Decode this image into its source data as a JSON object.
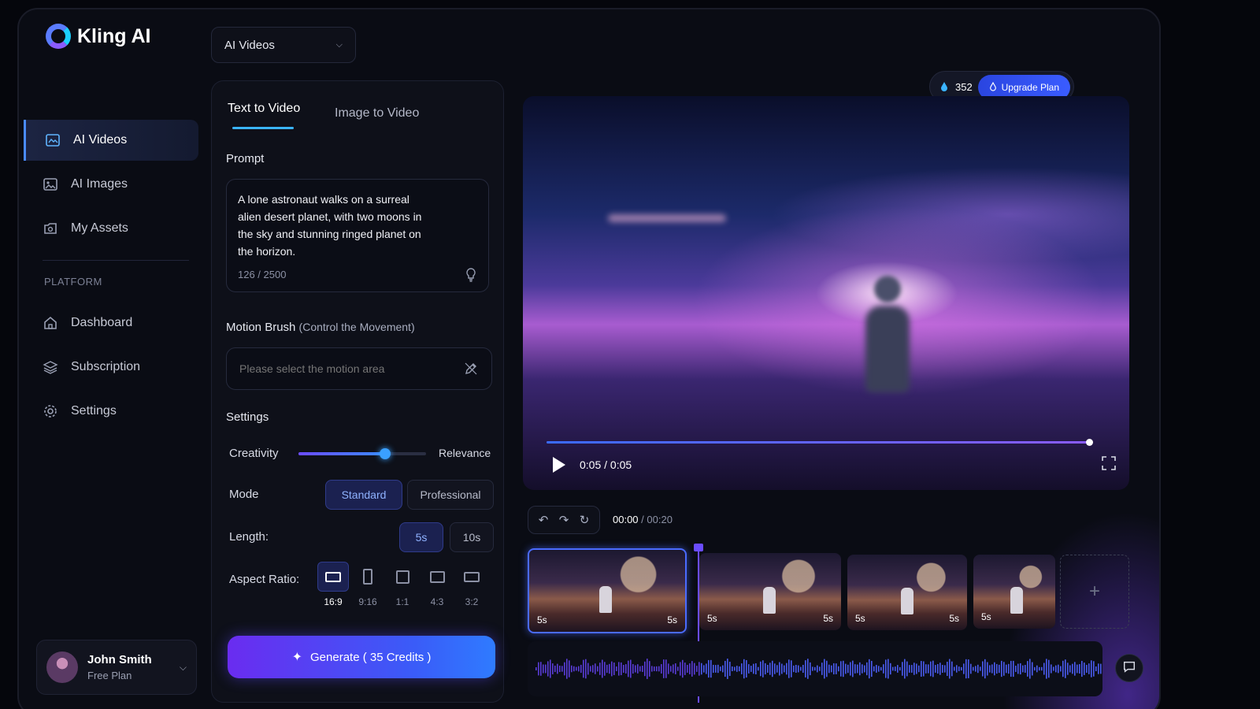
{
  "brand": {
    "name": "Kling AI"
  },
  "sidebar": {
    "items": [
      {
        "label": "AI Videos",
        "icon": "video-icon",
        "active": true
      },
      {
        "label": "AI Images",
        "icon": "image-icon",
        "active": false
      },
      {
        "label": "My Assets",
        "icon": "assets-icon",
        "active": false
      }
    ],
    "section_label": "PLATFORM",
    "platform_items": [
      {
        "label": "Dashboard",
        "icon": "home-icon"
      },
      {
        "label": "Subscription",
        "icon": "layers-icon"
      },
      {
        "label": "Settings",
        "icon": "gear-icon"
      }
    ]
  },
  "user": {
    "name": "John Smith",
    "plan": "Free Plan"
  },
  "top_select": {
    "value": "AI Videos"
  },
  "tabs": [
    {
      "label": "Text to Video",
      "active": true
    },
    {
      "label": "Image to Video",
      "active": false
    }
  ],
  "prompt": {
    "label": "Prompt",
    "value": "A lone astronaut walks on a surreal alien desert planet, with two moons in the sky and stunning ringed planet on the horizon.",
    "counter": "126 / 2500"
  },
  "motion_brush": {
    "label": "Motion Brush",
    "sublabel": "(Control the Movement)",
    "placeholder": "Please select the motion area"
  },
  "settings": {
    "label": "Settings",
    "creativity_label": "Creativity",
    "relevance_label": "Relevance",
    "slider_value": 0.68,
    "mode_label": "Mode",
    "modes": [
      {
        "label": "Standard",
        "active": true
      },
      {
        "label": "Professional",
        "active": false
      }
    ],
    "length_label": "Length:",
    "lengths": [
      {
        "label": "5s",
        "active": true
      },
      {
        "label": "10s",
        "active": false
      }
    ],
    "aspect_label": "Aspect Ratio:",
    "aspects": [
      {
        "label": "16:9",
        "active": true
      },
      {
        "label": "9:16",
        "active": false
      },
      {
        "label": "1:1",
        "active": false
      },
      {
        "label": "4:3",
        "active": false
      },
      {
        "label": "3:2",
        "active": false
      }
    ]
  },
  "generate": {
    "label": "Generate ( 35 Credits )"
  },
  "credits": {
    "value": "352",
    "upgrade_label": "Upgrade Plan"
  },
  "player": {
    "time": "0:05 / 0:05",
    "progress": 1.0
  },
  "timeline": {
    "current": "00:00",
    "total": "/ 00:20",
    "clips": [
      {
        "start_label": "5s",
        "end_label": "5s",
        "active": true
      },
      {
        "start_label": "5s",
        "end_label": "5s",
        "active": false
      },
      {
        "start_label": "5s",
        "end_label": "5s",
        "active": false
      },
      {
        "start_label": "5s",
        "end_label": "",
        "active": false
      }
    ],
    "add_label": "+"
  }
}
